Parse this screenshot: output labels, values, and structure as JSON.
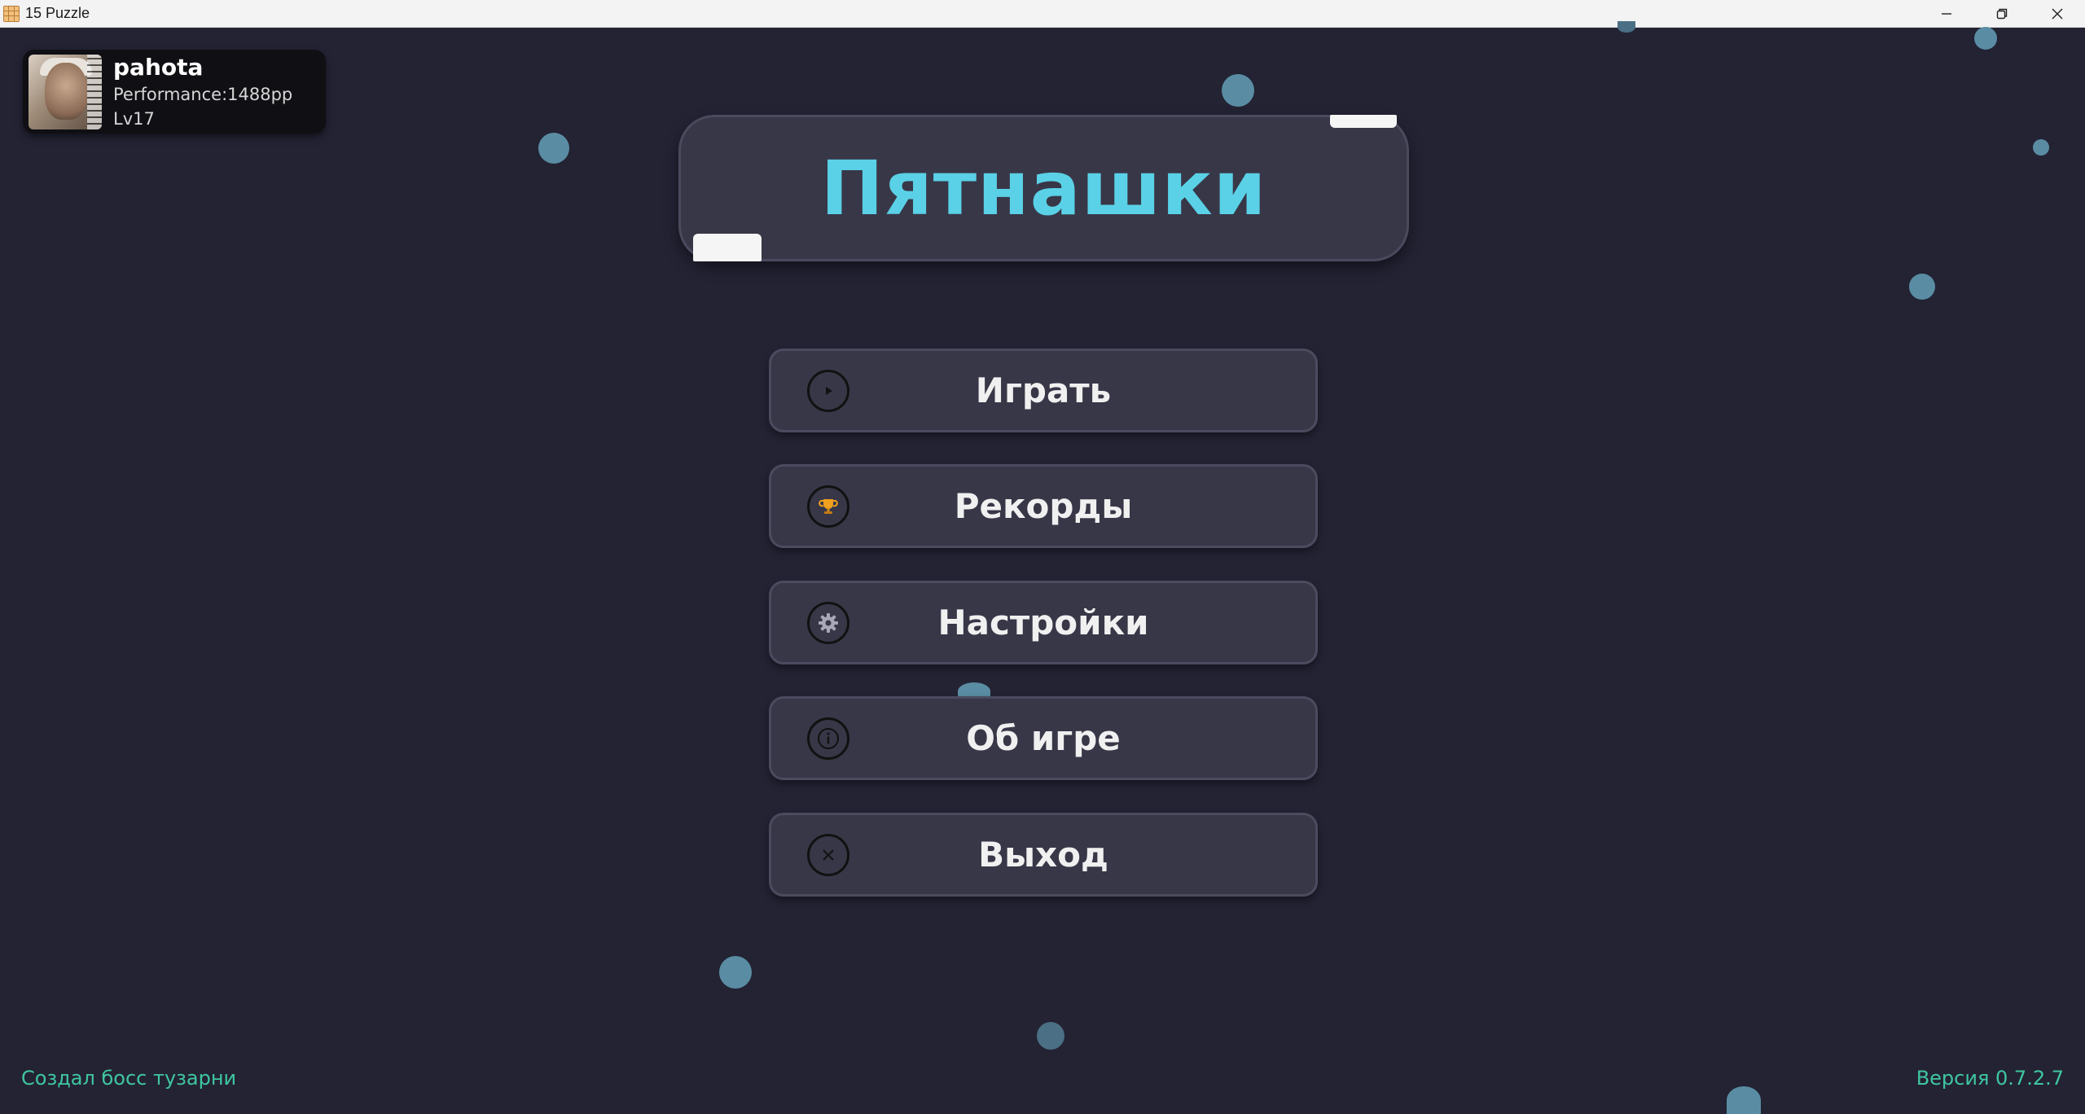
{
  "window": {
    "title": "15 Puzzle",
    "minimize_icon": "minimize-icon",
    "restore_icon": "restore-icon",
    "close_icon": "close-icon"
  },
  "profile": {
    "name": "pahota",
    "performance": "Performance:1488pp",
    "level": "Lv17"
  },
  "game": {
    "title": "Пятнашки"
  },
  "menu": {
    "play": {
      "label": "Играть",
      "icon": "play-icon"
    },
    "records": {
      "label": "Рекорды",
      "icon": "trophy-icon"
    },
    "settings": {
      "label": "Настройки",
      "icon": "gear-icon"
    },
    "about": {
      "label": "Об игре",
      "icon": "info-icon"
    },
    "exit": {
      "label": "Выход",
      "icon": "close-icon"
    }
  },
  "footer": {
    "credit": "Создал босс тузарни",
    "version": "Версия 0.7.2.7"
  },
  "colors": {
    "background": "#232334",
    "title_accent": "#5ad1e6",
    "footer_text": "#3fc6a0",
    "button_bg": "#383748",
    "dot": "#5a8da3",
    "trophy": "#f0a020"
  }
}
